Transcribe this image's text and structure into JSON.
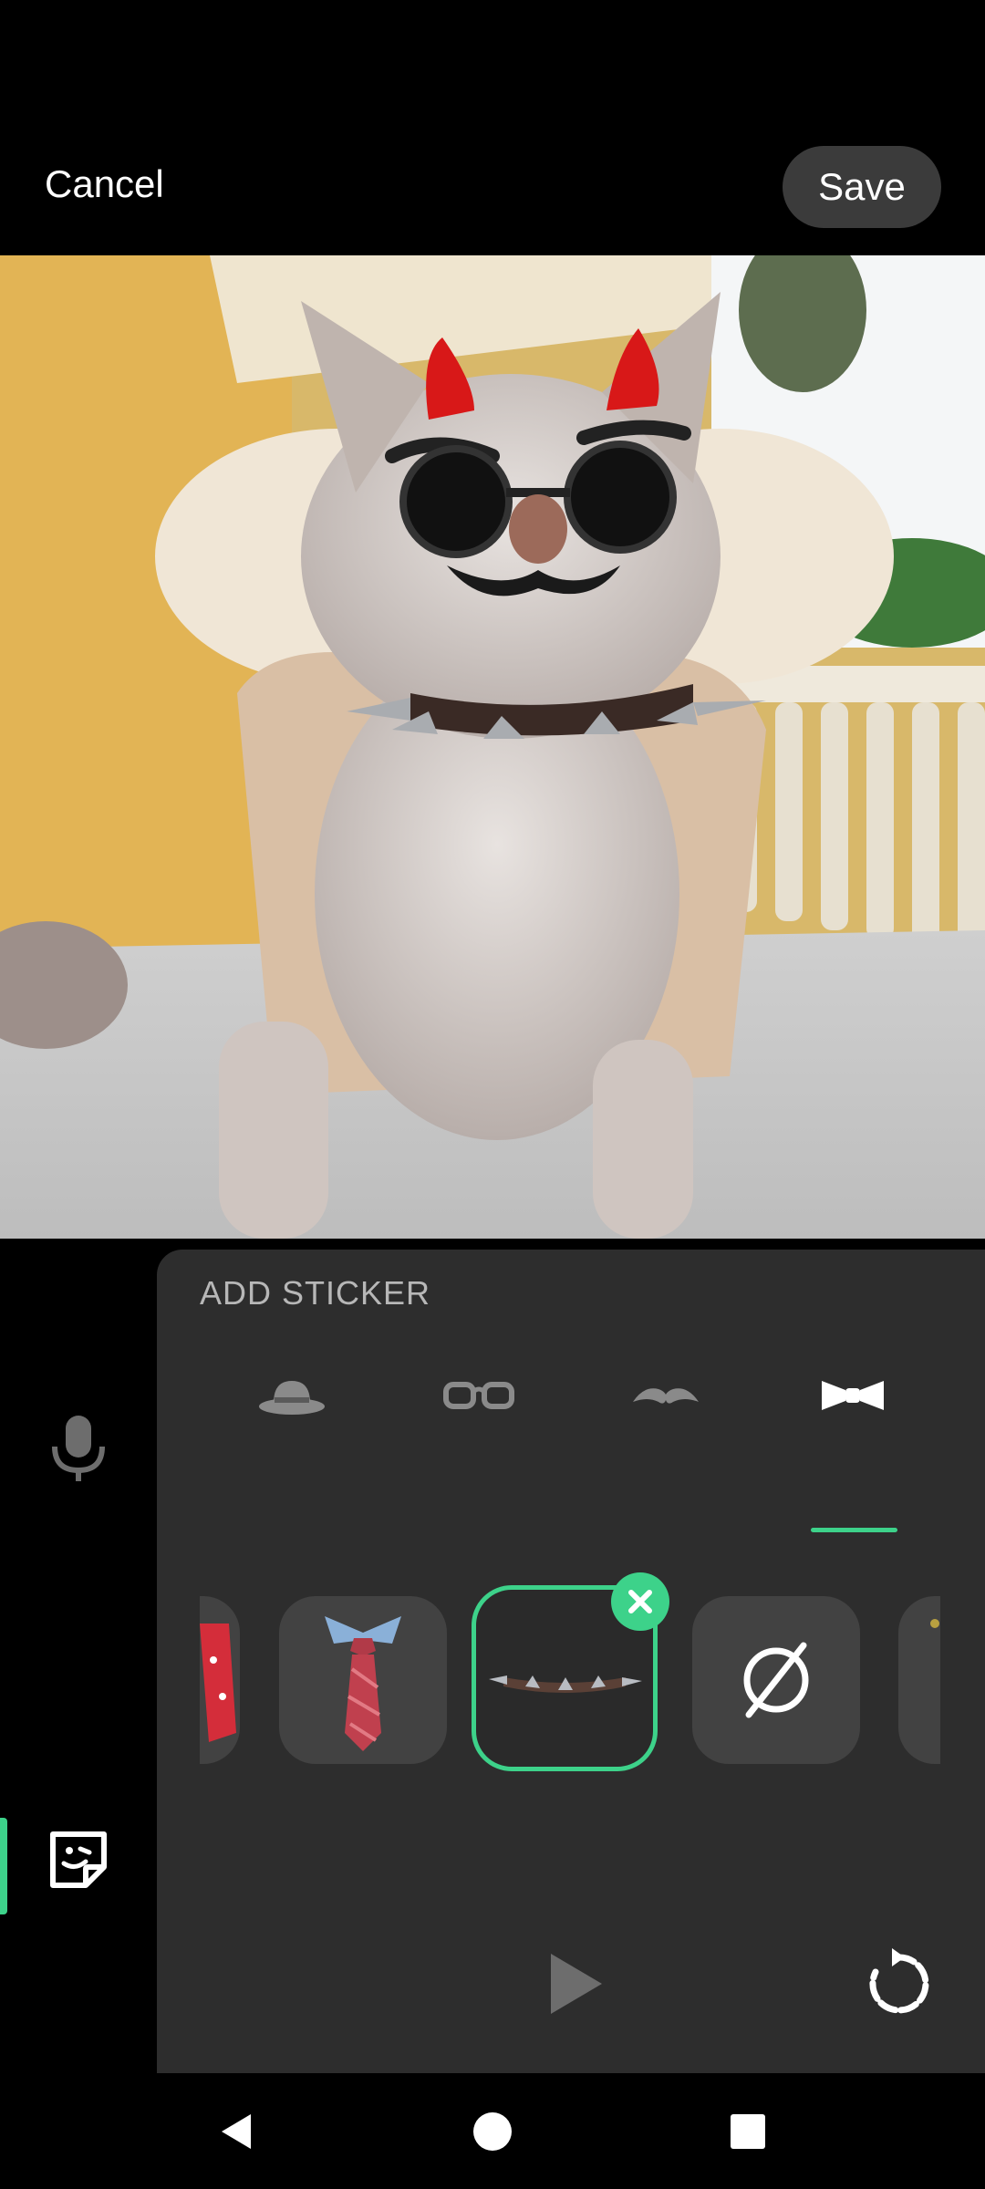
{
  "header": {
    "cancel_label": "Cancel",
    "save_label": "Save"
  },
  "panel": {
    "title": "ADD STICKER",
    "tabs": [
      {
        "icon": "hat-icon"
      },
      {
        "icon": "glasses-icon"
      },
      {
        "icon": "mustache-icon"
      },
      {
        "icon": "bowtie-icon",
        "selected": true
      }
    ],
    "stickers": [
      {
        "icon": "red-tie-icon"
      },
      {
        "icon": "necktie-icon"
      },
      {
        "icon": "spiked-collar-icon",
        "selected": true
      },
      {
        "icon": "none-icon"
      },
      {
        "icon": "partial-sticker-icon"
      }
    ]
  },
  "left_rail": {
    "tools": [
      {
        "icon": "microphone-icon"
      },
      {
        "icon": "sticker-icon",
        "selected": true
      }
    ]
  },
  "colors": {
    "accent": "#3dd28a",
    "panel_bg": "#2d2d2d",
    "item_bg": "#424242"
  }
}
